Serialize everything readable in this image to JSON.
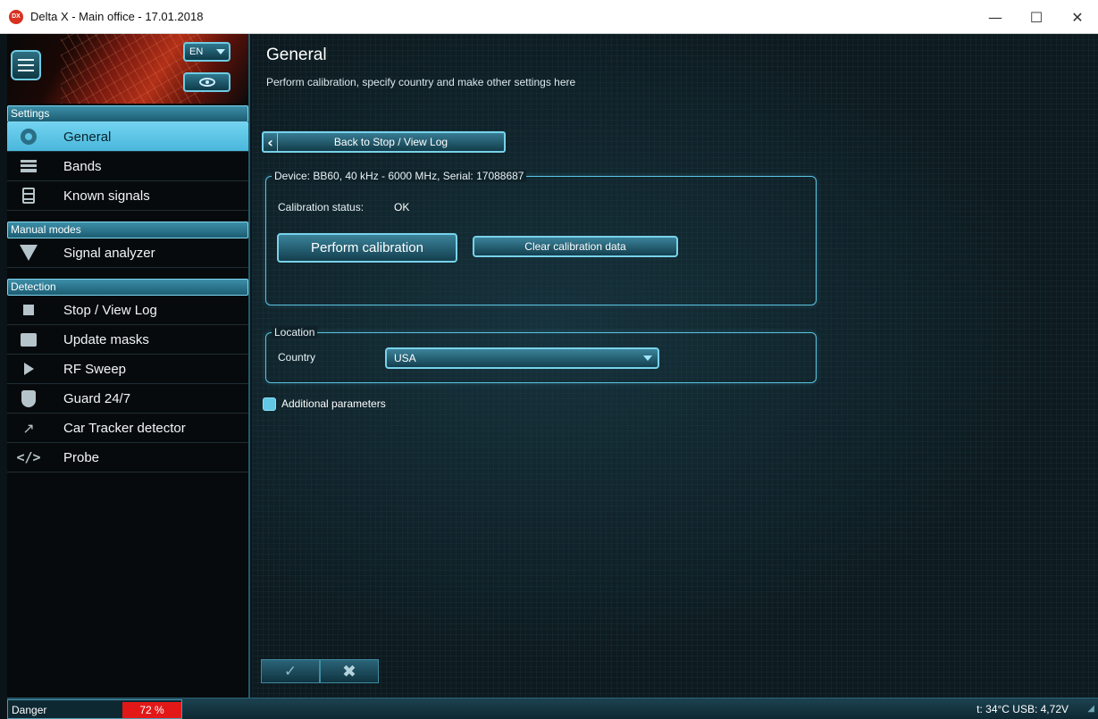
{
  "window": {
    "title": "Delta X - Main office - 17.01.2018",
    "logo_text": "DX",
    "minimize": "—",
    "maximize": "☐",
    "close": "✕"
  },
  "sidebar": {
    "language": "EN",
    "sections": [
      {
        "title": "Settings",
        "items": [
          {
            "label": "General",
            "icon": "gear-icon",
            "active": true
          },
          {
            "label": "Bands",
            "icon": "bands-icon"
          },
          {
            "label": "Known signals",
            "icon": "clipboard-icon"
          }
        ]
      },
      {
        "title": "Manual modes",
        "items": [
          {
            "label": "Signal analyzer",
            "icon": "signal-analyzer-icon"
          }
        ]
      },
      {
        "title": "Detection",
        "items": [
          {
            "label": "Stop / View Log",
            "icon": "stop-icon"
          },
          {
            "label": "Update masks",
            "icon": "image-icon"
          },
          {
            "label": "RF Sweep",
            "icon": "play-icon"
          },
          {
            "label": "Guard 24/7",
            "icon": "shield-icon"
          },
          {
            "label": "Car Tracker detector",
            "icon": "trend-icon"
          },
          {
            "label": "Probe",
            "icon": "code-icon"
          }
        ]
      }
    ]
  },
  "main": {
    "title": "General",
    "subtitle": "Perform calibration, specify country and make other settings here",
    "back_button": "Back to Stop / View Log",
    "device": {
      "legend": "Device: BB60, 40 kHz - 6000 MHz, Serial: 17088687",
      "calibration_label": "Calibration status:",
      "calibration_value": "OK",
      "perform_button": "Perform calibration",
      "clear_button": "Clear calibration data"
    },
    "location": {
      "legend": "Location",
      "country_label": "Country",
      "country_value": "USA"
    },
    "additional": {
      "label": "Additional parameters",
      "checked": true
    },
    "ok_symbol": "✓",
    "cancel_symbol": "✖"
  },
  "statusbar": {
    "danger_label": "Danger",
    "danger_value": "72 %",
    "danger_color": "#e21818",
    "right_text": "t: 34°C  USB: 4,72V"
  },
  "colors": {
    "accent": "#72d3f0",
    "panel_border": "#5ac4e2"
  }
}
